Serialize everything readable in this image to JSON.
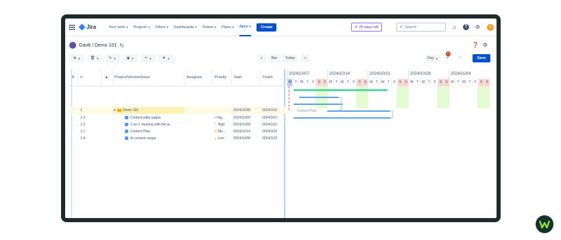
{
  "topnav": {
    "app_name": "Jira",
    "items": [
      {
        "label": "Your work"
      },
      {
        "label": "Projects"
      },
      {
        "label": "Filters"
      },
      {
        "label": "Dashboards"
      },
      {
        "label": "Teams"
      },
      {
        "label": "Plans"
      },
      {
        "label": "Apps"
      }
    ],
    "create_label": "Create",
    "trial_label": "26 days left",
    "search_placeholder": "Search",
    "avatar_initial": "K"
  },
  "title": {
    "text": "Gantt / Demo 101"
  },
  "toolbar": {
    "nav_prev": "«",
    "bar_label": "Bar",
    "today_label": "Today",
    "nav_next": "»",
    "scale_label": "Day",
    "badge_count": "10",
    "save_label": "Save"
  },
  "table": {
    "columns": [
      "#",
      "Project/Version/Issue",
      "Assignee",
      "Priority",
      "Start",
      "Finish"
    ],
    "rows": [
      {
        "num": "1",
        "name": "Demo 101",
        "assignee": "",
        "priority": "",
        "start": "2024/10/08",
        "finish": "2024/10/2",
        "kind": "folder",
        "selected": true
      },
      {
        "num": "1-3",
        "name": "Content pillar pages",
        "assignee": "",
        "priority": "Hig...",
        "start": "2024/10/09",
        "finish": "2024/10/1",
        "kind": "task"
      },
      {
        "num": "1-2",
        "name": "1-on-1 meeting with the w...",
        "assignee": "",
        "priority": "High",
        "start": "2024/10/08",
        "finish": "2024/10/1",
        "kind": "task"
      },
      {
        "num": "1-1",
        "name": "Content Plan",
        "assignee": "",
        "priority": "Me...",
        "start": "2024/10/14",
        "finish": "2024/10/2",
        "kind": "task"
      },
      {
        "num": "1-4",
        "name": "AI content usage",
        "assignee": "",
        "priority": "Low",
        "start": "2024/10/08",
        "finish": "2024/10/2",
        "kind": "task"
      }
    ]
  },
  "gantt": {
    "weeks": [
      "2024/10/07",
      "2024/10/14",
      "2024/10/21",
      "2024/10/28",
      "2024/11/04"
    ],
    "days": [
      "M",
      "T",
      "W",
      "T",
      "F",
      "S",
      "S",
      "M",
      "T",
      "W",
      "T",
      "F",
      "S",
      "S",
      "M",
      "T",
      "W",
      "T",
      "F",
      "S",
      "S",
      "M",
      "T",
      "W",
      "T",
      "F",
      "S",
      "S",
      "M",
      "T",
      "W",
      "T",
      "F",
      "S",
      "S"
    ],
    "bar_label": "Content Plan"
  },
  "colors": {
    "accent": "#0052cc",
    "weekend": "#e3fcd2",
    "bar": "#5ba4e8",
    "summary_bar": "#57d9a3"
  }
}
